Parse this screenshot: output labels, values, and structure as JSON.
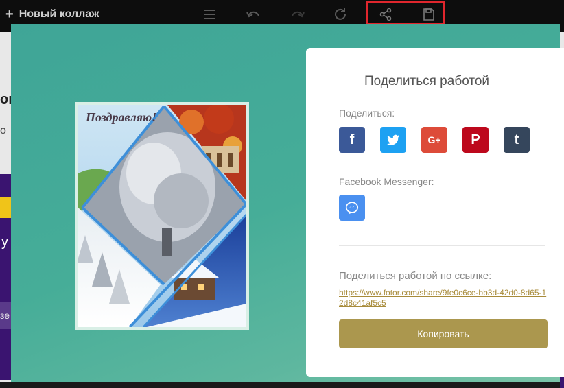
{
  "toolbar": {
    "new_collage_label": "Новый коллаж",
    "icons": [
      "menu-icon",
      "undo-icon",
      "redo-icon",
      "refresh-icon",
      "share-icon",
      "save-icon"
    ]
  },
  "background": {
    "partial_text_1": "ок",
    "partial_text_2": "о",
    "partial_text_3": "у",
    "partial_text_4": "зе"
  },
  "collage": {
    "greeting": "Поздравляю!"
  },
  "share_card": {
    "title": "Поделиться работой",
    "share_label": "Поделиться:",
    "social_buttons": [
      {
        "name": "facebook",
        "glyph": "f",
        "color": "#3b5998"
      },
      {
        "name": "twitter",
        "glyph": "t",
        "color": "#1da1f2"
      },
      {
        "name": "google-plus",
        "glyph": "G+",
        "color": "#dd4b39"
      },
      {
        "name": "pinterest",
        "glyph": "P",
        "color": "#bd081c"
      },
      {
        "name": "tumblr",
        "glyph": "t",
        "color": "#35465c"
      }
    ],
    "messenger_label": "Facebook Messenger:",
    "messenger_color": "#4a90f0",
    "link_label": "Поделиться работой по ссылке:",
    "link_url": "https://www.fotor.com/share/9fe0c6ce-bb3d-42d0-8d65-12d8c41af5c5",
    "copy_label": "Копировать"
  },
  "colors": {
    "accent": "#ab974e",
    "modal_teal": "#46ad98",
    "highlight": "#e0262d"
  }
}
